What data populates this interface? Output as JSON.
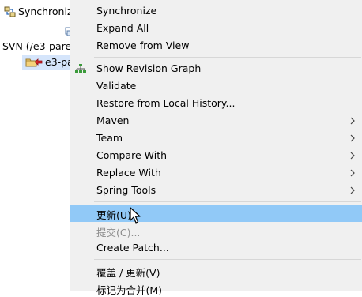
{
  "sync_view": {
    "tab_title": "Synchronize",
    "tab_icon": "synchronize-view-icon",
    "toolbar_icon": "toolbar-action-icon",
    "root_label": "SVN (/e3-pare",
    "project_label": "e3-pa",
    "project_icon": "project-outgoing-change-icon"
  },
  "context_menu": {
    "items": [
      {
        "label": "Synchronize"
      },
      {
        "label": "Expand All"
      },
      {
        "label": "Remove from View"
      },
      {
        "label": "Show Revision Graph",
        "icon": "revision-graph-icon"
      },
      {
        "label": "Validate"
      },
      {
        "label": "Restore from Local History..."
      },
      {
        "label": "Maven",
        "submenu": true
      },
      {
        "label": "Team",
        "submenu": true
      },
      {
        "label": "Compare With",
        "submenu": true
      },
      {
        "label": "Replace With",
        "submenu": true
      },
      {
        "label": "Spring Tools",
        "submenu": true
      },
      {
        "label": "更新(U)",
        "highlighted": true
      },
      {
        "label": "提交(C)...",
        "disabled": true
      },
      {
        "label": "Create Patch..."
      },
      {
        "label": "覆盖 / 更新(V)"
      },
      {
        "label": "标记为合并(M)"
      }
    ]
  },
  "colors": {
    "menu_background": "#f0f0f0",
    "highlight": "#91c9f7",
    "disabled_text": "#8d8d8d",
    "separator": "#d7d7d7",
    "selected_row": "#d5e5fb"
  }
}
